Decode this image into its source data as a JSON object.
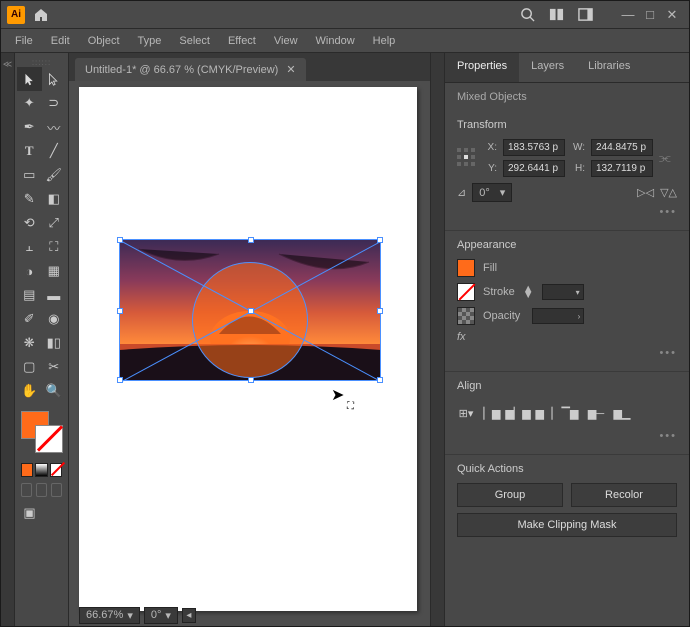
{
  "titlebar": {
    "app_short": "Ai",
    "search_placeholder": "",
    "window": {
      "min": "—",
      "max": "□",
      "close": "✕"
    }
  },
  "menu": {
    "file": "File",
    "edit": "Edit",
    "object": "Object",
    "type": "Type",
    "select": "Select",
    "effect": "Effect",
    "view": "View",
    "window": "Window",
    "help": "Help"
  },
  "document": {
    "tab_label": "Untitled-1* @ 66.67 % (CMYK/Preview)",
    "close": "✕"
  },
  "status": {
    "zoom": "66.67%",
    "angle": "0°"
  },
  "panels": {
    "tabs": {
      "properties": "Properties",
      "layers": "Layers",
      "libraries": "Libraries"
    },
    "selection": "Mixed Objects",
    "transform": {
      "title": "Transform",
      "x_label": "X:",
      "x": "183.5763 p",
      "y_label": "Y:",
      "y": "292.6441 p",
      "w_label": "W:",
      "w": "244.8475 p",
      "h_label": "H:",
      "h": "132.7119 p",
      "angle": "0°"
    },
    "appearance": {
      "title": "Appearance",
      "fill": "Fill",
      "stroke": "Stroke",
      "opacity": "Opacity",
      "fx": "fx"
    },
    "align": {
      "title": "Align"
    },
    "quick": {
      "title": "Quick Actions",
      "group": "Group",
      "recolor": "Recolor",
      "mask": "Make Clipping Mask"
    }
  },
  "colors": {
    "fill": "#ff6b1a"
  }
}
